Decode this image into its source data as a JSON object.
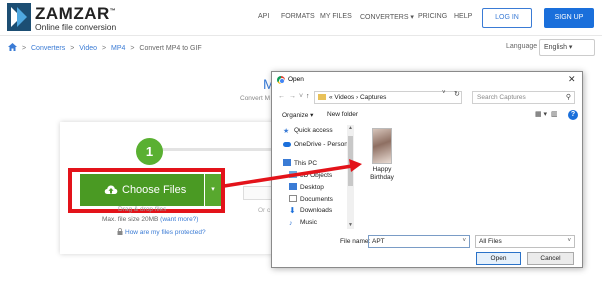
{
  "header": {
    "brand": "ZAMZAR",
    "tm": "™",
    "tagline": "Online file conversion",
    "nav": [
      {
        "label": "API"
      },
      {
        "label": "FORMATS"
      },
      {
        "label": "MY FILES"
      },
      {
        "label": "CONVERTERS ▾"
      },
      {
        "label": "PRICING"
      },
      {
        "label": "HELP"
      }
    ],
    "login_label": "LOG IN",
    "signup_label": "SIGN UP"
  },
  "breadcrumb": {
    "items": [
      "Converters",
      "Video",
      "MP4"
    ],
    "current": "Convert MP4 to GIF",
    "separator": ">"
  },
  "language": {
    "label": "Language",
    "selected": "English ▾"
  },
  "page": {
    "title_fragment": "M",
    "subtitle_fragment": "Convert M"
  },
  "uploader": {
    "step_number": "1",
    "choose_files_label": "Choose Files",
    "dropdown_caret": "▾",
    "drag_text": "Drag & drop files",
    "max_size_text": "Max. file size 20MB",
    "max_size_link": "(want more?)",
    "protected_link": "How are my files protected?",
    "or_text": "Or c"
  },
  "dialog": {
    "title": "Open",
    "close": "✕",
    "address": "«  Videos  ›  Captures",
    "search_placeholder": "Search Captures",
    "organize_label": "Organize ▾",
    "new_folder_label": "New folder",
    "nav_items": [
      {
        "label": "Quick access",
        "icon": "star-icon",
        "color": "#3a7bd5"
      },
      {
        "label": "OneDrive - Persona",
        "icon": "cloud-icon",
        "color": "#1a6fdb"
      },
      {
        "label": "This PC",
        "icon": "pc-icon",
        "color": "#3a7bd5"
      },
      {
        "label": "3D Objects",
        "icon": "cube-icon",
        "color": "#6aa8e0"
      },
      {
        "label": "Desktop",
        "icon": "desktop-icon",
        "color": "#3a7bd5"
      },
      {
        "label": "Documents",
        "icon": "document-icon",
        "color": "#8a8a8a"
      },
      {
        "label": "Downloads",
        "icon": "download-icon",
        "color": "#1a6fdb"
      },
      {
        "label": "Music",
        "icon": "music-icon",
        "color": "#3a7bd5"
      }
    ],
    "file": {
      "name": "Happy Birthday"
    },
    "file_name_label": "File name:",
    "file_name_value": "APT",
    "filter_value": "All Files",
    "open_label": "Open",
    "cancel_label": "Cancel"
  },
  "colors": {
    "accent": "#3a7bd5",
    "primary_button": "#1a6fdb",
    "choose_files_green": "#4a9a23",
    "highlight_red": "#e3131a"
  }
}
